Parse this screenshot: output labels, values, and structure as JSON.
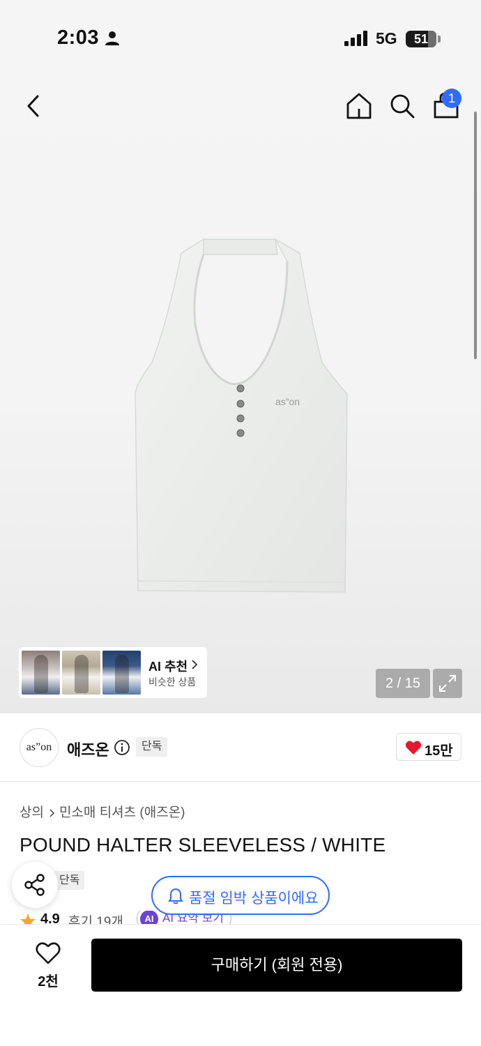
{
  "status_bar": {
    "time": "2:03",
    "network": "5G",
    "battery": "51"
  },
  "header": {
    "cart_count": "1"
  },
  "gallery": {
    "page_counter": "2 / 15",
    "ai_recommend": {
      "title": "AI 추천",
      "subtitle": "비슷한 상품"
    }
  },
  "brand": {
    "logo_text": "as”on",
    "name": "애즈온",
    "badge": "단독",
    "like_count": "15만"
  },
  "product": {
    "breadcrumb": [
      "상의",
      "민소매 티셔츠 (애즈온)"
    ],
    "title": "POUND HALTER SLEEVELESS / WHITE",
    "tag": "단독",
    "rating": "4.9",
    "reviews": "후기 19개",
    "ai_summary_badge": "AI",
    "ai_summary_label": "AI 요약 보기",
    "print_text": "as”on"
  },
  "notice": {
    "soldout_label": "품절 임박 상품이에요"
  },
  "bottom_bar": {
    "wish_count": "2천",
    "buy_label": "구매하기 (회원 전용)"
  },
  "colors": {
    "accent_blue": "#2f6bff",
    "heart_red": "#e8172c",
    "ai_purple": "#6b43d6",
    "star_orange": "#f5a623"
  },
  "icons": [
    "person-icon",
    "signal-icon",
    "back-icon",
    "home-icon",
    "search-icon",
    "bag-icon",
    "chevron-right-icon",
    "expand-icon",
    "info-icon",
    "heart-icon",
    "share-icon",
    "bell-icon",
    "star-icon"
  ]
}
